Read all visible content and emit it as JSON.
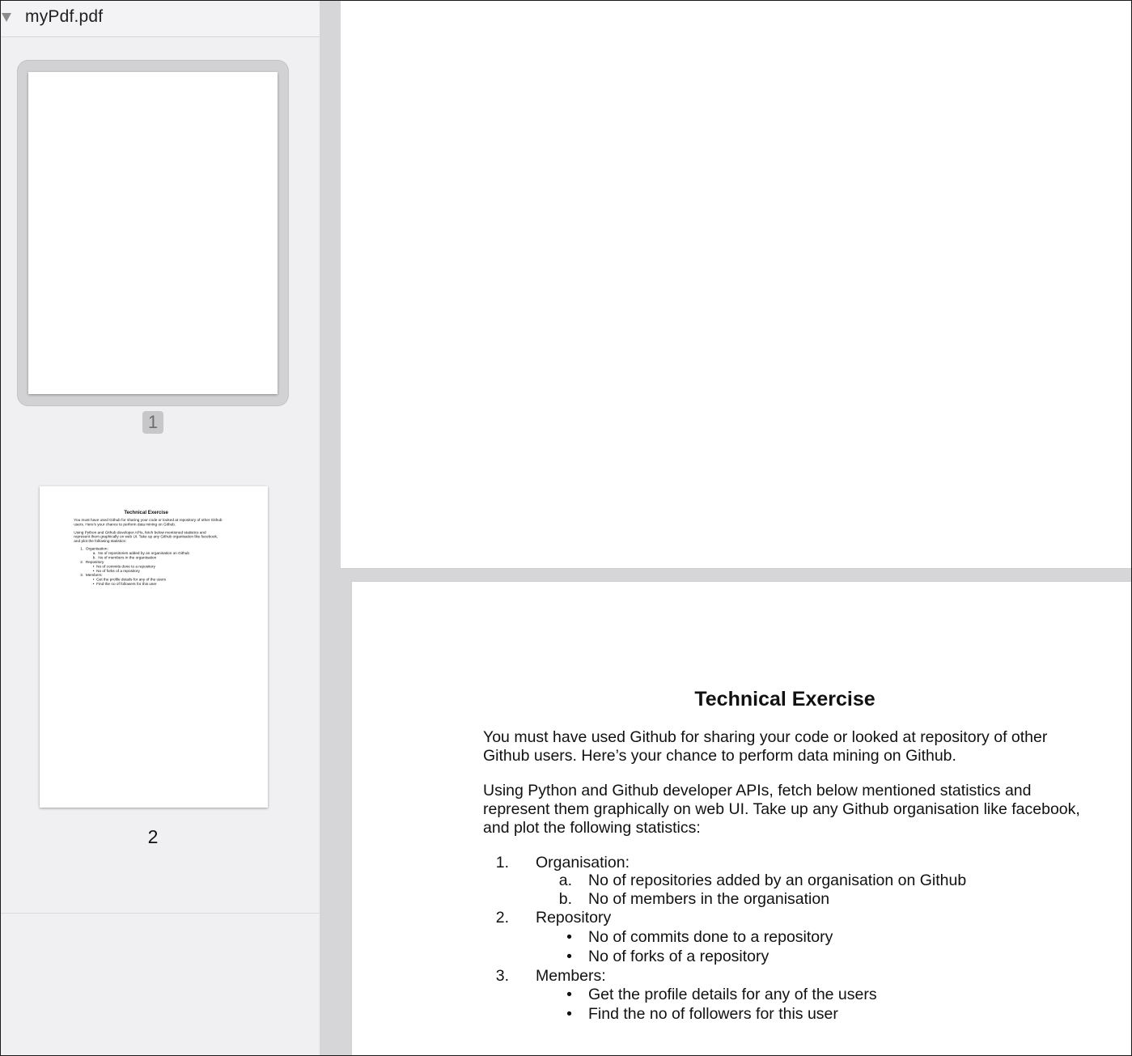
{
  "sidebar": {
    "file_name": "myPdf.pdf",
    "pages": [
      {
        "number": "1",
        "selected": true
      },
      {
        "number": "2",
        "selected": false
      }
    ]
  },
  "document": {
    "title": "Technical Exercise",
    "paragraphs": [
      "You must have used Github for sharing your code or looked at repository of other Github users. Here’s your chance to perform data mining on Github.",
      "Using Python and Github developer APIs, fetch below mentioned statistics and represent them graphically on web UI. Take up any Github organisation like facebook, and plot the following statistics:"
    ],
    "list": [
      {
        "marker": "1.",
        "label": "Organisation:",
        "items": [
          {
            "marker": "a.",
            "label": "No of repositories added by an organisation on Github"
          },
          {
            "marker": "b.",
            "label": "No of members in the organisation"
          }
        ]
      },
      {
        "marker": "2.",
        "label": "Repository",
        "items": [
          {
            "marker": "•",
            "label": "No of commits done to a repository"
          },
          {
            "marker": "•",
            "label": "No of forks of a repository"
          }
        ]
      },
      {
        "marker": "3.",
        "label": "Members:",
        "items": [
          {
            "marker": "•",
            "label": "Get the profile details for any of the users"
          },
          {
            "marker": "•",
            "label": "Find the no of followers for this user"
          }
        ]
      }
    ]
  }
}
